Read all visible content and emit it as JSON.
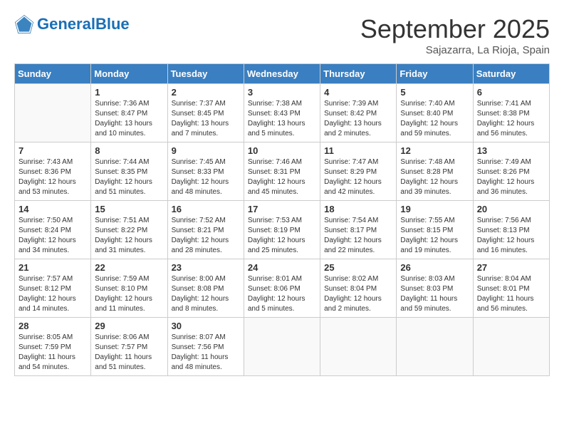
{
  "logo": {
    "text_general": "General",
    "text_blue": "Blue"
  },
  "calendar": {
    "title": "September 2025",
    "subtitle": "Sajazarra, La Rioja, Spain"
  },
  "weekdays": [
    "Sunday",
    "Monday",
    "Tuesday",
    "Wednesday",
    "Thursday",
    "Friday",
    "Saturday"
  ],
  "weeks": [
    [
      {
        "day": "",
        "sunrise": "",
        "sunset": "",
        "daylight": ""
      },
      {
        "day": "1",
        "sunrise": "Sunrise: 7:36 AM",
        "sunset": "Sunset: 8:47 PM",
        "daylight": "Daylight: 13 hours and 10 minutes."
      },
      {
        "day": "2",
        "sunrise": "Sunrise: 7:37 AM",
        "sunset": "Sunset: 8:45 PM",
        "daylight": "Daylight: 13 hours and 7 minutes."
      },
      {
        "day": "3",
        "sunrise": "Sunrise: 7:38 AM",
        "sunset": "Sunset: 8:43 PM",
        "daylight": "Daylight: 13 hours and 5 minutes."
      },
      {
        "day": "4",
        "sunrise": "Sunrise: 7:39 AM",
        "sunset": "Sunset: 8:42 PM",
        "daylight": "Daylight: 13 hours and 2 minutes."
      },
      {
        "day": "5",
        "sunrise": "Sunrise: 7:40 AM",
        "sunset": "Sunset: 8:40 PM",
        "daylight": "Daylight: 12 hours and 59 minutes."
      },
      {
        "day": "6",
        "sunrise": "Sunrise: 7:41 AM",
        "sunset": "Sunset: 8:38 PM",
        "daylight": "Daylight: 12 hours and 56 minutes."
      }
    ],
    [
      {
        "day": "7",
        "sunrise": "Sunrise: 7:43 AM",
        "sunset": "Sunset: 8:36 PM",
        "daylight": "Daylight: 12 hours and 53 minutes."
      },
      {
        "day": "8",
        "sunrise": "Sunrise: 7:44 AM",
        "sunset": "Sunset: 8:35 PM",
        "daylight": "Daylight: 12 hours and 51 minutes."
      },
      {
        "day": "9",
        "sunrise": "Sunrise: 7:45 AM",
        "sunset": "Sunset: 8:33 PM",
        "daylight": "Daylight: 12 hours and 48 minutes."
      },
      {
        "day": "10",
        "sunrise": "Sunrise: 7:46 AM",
        "sunset": "Sunset: 8:31 PM",
        "daylight": "Daylight: 12 hours and 45 minutes."
      },
      {
        "day": "11",
        "sunrise": "Sunrise: 7:47 AM",
        "sunset": "Sunset: 8:29 PM",
        "daylight": "Daylight: 12 hours and 42 minutes."
      },
      {
        "day": "12",
        "sunrise": "Sunrise: 7:48 AM",
        "sunset": "Sunset: 8:28 PM",
        "daylight": "Daylight: 12 hours and 39 minutes."
      },
      {
        "day": "13",
        "sunrise": "Sunrise: 7:49 AM",
        "sunset": "Sunset: 8:26 PM",
        "daylight": "Daylight: 12 hours and 36 minutes."
      }
    ],
    [
      {
        "day": "14",
        "sunrise": "Sunrise: 7:50 AM",
        "sunset": "Sunset: 8:24 PM",
        "daylight": "Daylight: 12 hours and 34 minutes."
      },
      {
        "day": "15",
        "sunrise": "Sunrise: 7:51 AM",
        "sunset": "Sunset: 8:22 PM",
        "daylight": "Daylight: 12 hours and 31 minutes."
      },
      {
        "day": "16",
        "sunrise": "Sunrise: 7:52 AM",
        "sunset": "Sunset: 8:21 PM",
        "daylight": "Daylight: 12 hours and 28 minutes."
      },
      {
        "day": "17",
        "sunrise": "Sunrise: 7:53 AM",
        "sunset": "Sunset: 8:19 PM",
        "daylight": "Daylight: 12 hours and 25 minutes."
      },
      {
        "day": "18",
        "sunrise": "Sunrise: 7:54 AM",
        "sunset": "Sunset: 8:17 PM",
        "daylight": "Daylight: 12 hours and 22 minutes."
      },
      {
        "day": "19",
        "sunrise": "Sunrise: 7:55 AM",
        "sunset": "Sunset: 8:15 PM",
        "daylight": "Daylight: 12 hours and 19 minutes."
      },
      {
        "day": "20",
        "sunrise": "Sunrise: 7:56 AM",
        "sunset": "Sunset: 8:13 PM",
        "daylight": "Daylight: 12 hours and 16 minutes."
      }
    ],
    [
      {
        "day": "21",
        "sunrise": "Sunrise: 7:57 AM",
        "sunset": "Sunset: 8:12 PM",
        "daylight": "Daylight: 12 hours and 14 minutes."
      },
      {
        "day": "22",
        "sunrise": "Sunrise: 7:59 AM",
        "sunset": "Sunset: 8:10 PM",
        "daylight": "Daylight: 12 hours and 11 minutes."
      },
      {
        "day": "23",
        "sunrise": "Sunrise: 8:00 AM",
        "sunset": "Sunset: 8:08 PM",
        "daylight": "Daylight: 12 hours and 8 minutes."
      },
      {
        "day": "24",
        "sunrise": "Sunrise: 8:01 AM",
        "sunset": "Sunset: 8:06 PM",
        "daylight": "Daylight: 12 hours and 5 minutes."
      },
      {
        "day": "25",
        "sunrise": "Sunrise: 8:02 AM",
        "sunset": "Sunset: 8:04 PM",
        "daylight": "Daylight: 12 hours and 2 minutes."
      },
      {
        "day": "26",
        "sunrise": "Sunrise: 8:03 AM",
        "sunset": "Sunset: 8:03 PM",
        "daylight": "Daylight: 11 hours and 59 minutes."
      },
      {
        "day": "27",
        "sunrise": "Sunrise: 8:04 AM",
        "sunset": "Sunset: 8:01 PM",
        "daylight": "Daylight: 11 hours and 56 minutes."
      }
    ],
    [
      {
        "day": "28",
        "sunrise": "Sunrise: 8:05 AM",
        "sunset": "Sunset: 7:59 PM",
        "daylight": "Daylight: 11 hours and 54 minutes."
      },
      {
        "day": "29",
        "sunrise": "Sunrise: 8:06 AM",
        "sunset": "Sunset: 7:57 PM",
        "daylight": "Daylight: 11 hours and 51 minutes."
      },
      {
        "day": "30",
        "sunrise": "Sunrise: 8:07 AM",
        "sunset": "Sunset: 7:56 PM",
        "daylight": "Daylight: 11 hours and 48 minutes."
      },
      {
        "day": "",
        "sunrise": "",
        "sunset": "",
        "daylight": ""
      },
      {
        "day": "",
        "sunrise": "",
        "sunset": "",
        "daylight": ""
      },
      {
        "day": "",
        "sunrise": "",
        "sunset": "",
        "daylight": ""
      },
      {
        "day": "",
        "sunrise": "",
        "sunset": "",
        "daylight": ""
      }
    ]
  ]
}
